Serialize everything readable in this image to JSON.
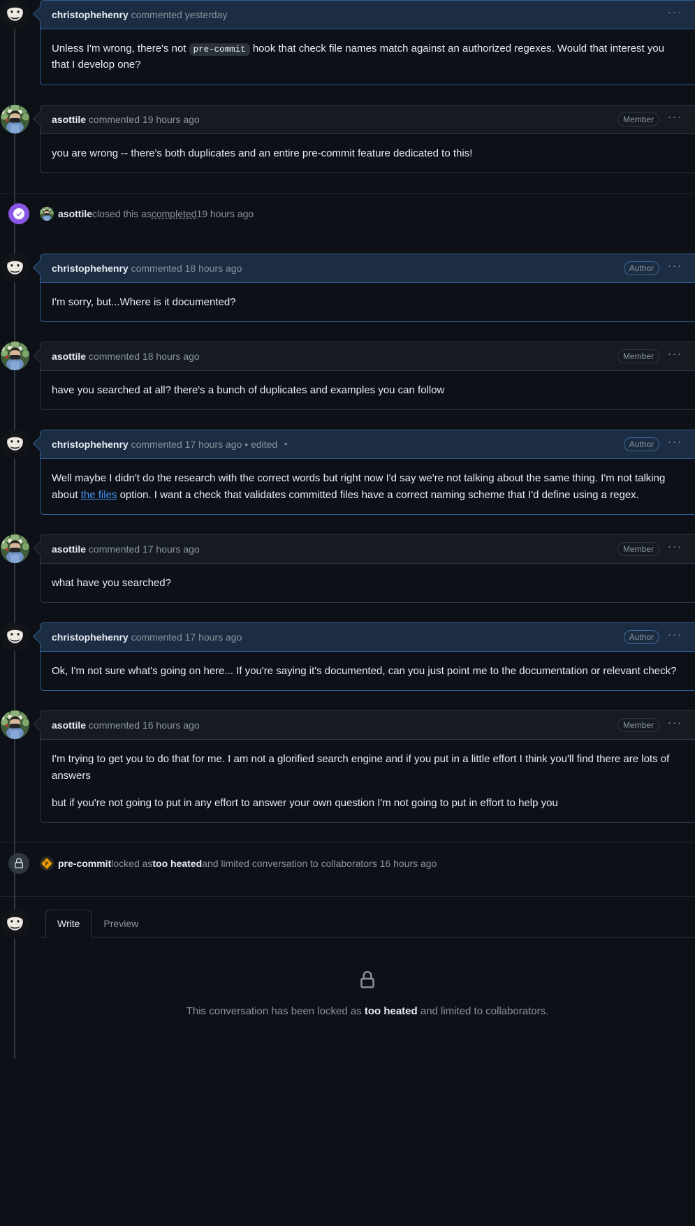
{
  "timeline": [
    {
      "type": "comment",
      "author": "christophehenry",
      "action": "commented",
      "time": "yesterday",
      "edited": "",
      "badge": "",
      "highlight": true,
      "kebab": "···",
      "avatar": "christophehenry-avatar",
      "paragraphs": [
        {
          "parts": [
            {
              "kind": "text",
              "text": "Unless I'm wrong, there's not "
            },
            {
              "kind": "code",
              "text": "pre-commit"
            },
            {
              "kind": "text",
              "text": " hook that check file names match against an authorized regexes. Would that interest you that I develop one?"
            }
          ]
        }
      ]
    },
    {
      "type": "comment",
      "author": "asottile",
      "action": "commented",
      "time": "19 hours ago",
      "edited": "",
      "badge": "Member",
      "highlight": false,
      "kebab": "···",
      "avatar": "asottile-avatar",
      "paragraphs": [
        {
          "parts": [
            {
              "kind": "text",
              "text": "you are wrong -- there's both duplicates and an entire pre-commit feature dedicated to this!"
            }
          ]
        }
      ]
    },
    {
      "type": "event",
      "icon": "closed-completed-icon",
      "icon_style": "purple",
      "actor": "asottile",
      "avatar": "asottile-avatar",
      "text_before": " closed this as ",
      "emphasis": "completed",
      "emphasis_style": "dotted",
      "text_after": " 19 hours ago"
    },
    {
      "type": "comment",
      "author": "christophehenry",
      "action": "commented",
      "time": "18 hours ago",
      "edited": "",
      "badge": "Author",
      "badge_style": "author",
      "highlight": true,
      "kebab": "···",
      "avatar": "christophehenry-avatar",
      "paragraphs": [
        {
          "parts": [
            {
              "kind": "text",
              "text": "I'm sorry, but...Where is it documented?"
            }
          ]
        }
      ]
    },
    {
      "type": "comment",
      "author": "asottile",
      "action": "commented",
      "time": "18 hours ago",
      "edited": "",
      "badge": "Member",
      "highlight": false,
      "kebab": "···",
      "avatar": "asottile-avatar",
      "paragraphs": [
        {
          "parts": [
            {
              "kind": "text",
              "text": "have you searched at all? there's a bunch of duplicates and examples you can follow"
            }
          ]
        }
      ]
    },
    {
      "type": "comment",
      "author": "christophehenry",
      "action": "commented",
      "time": "17 hours ago",
      "edited": "• edited",
      "badge": "Author",
      "badge_style": "author",
      "highlight": true,
      "kebab": "···",
      "avatar": "christophehenry-avatar",
      "paragraphs": [
        {
          "parts": [
            {
              "kind": "text",
              "text": "Well maybe I didn't do the research with the correct words but right now I'd say we're not talking about the same thing. I'm not talking about "
            },
            {
              "kind": "link",
              "text": "the files"
            },
            {
              "kind": "text",
              "text": " option. I want a check that validates committed files have a correct naming scheme that I'd define using a regex."
            }
          ]
        }
      ]
    },
    {
      "type": "comment",
      "author": "asottile",
      "action": "commented",
      "time": "17 hours ago",
      "edited": "",
      "badge": "Member",
      "highlight": false,
      "kebab": "···",
      "avatar": "asottile-avatar",
      "paragraphs": [
        {
          "parts": [
            {
              "kind": "text",
              "text": "what have you searched?"
            }
          ]
        }
      ]
    },
    {
      "type": "comment",
      "author": "christophehenry",
      "action": "commented",
      "time": "17 hours ago",
      "edited": "",
      "badge": "Author",
      "badge_style": "author",
      "highlight": true,
      "kebab": "···",
      "avatar": "christophehenry-avatar",
      "paragraphs": [
        {
          "parts": [
            {
              "kind": "text",
              "text": "Ok, I'm not sure what's going on here... If you're saying it's documented, can you just point me to the documentation or relevant check?"
            }
          ]
        }
      ]
    },
    {
      "type": "comment",
      "author": "asottile",
      "action": "commented",
      "time": "16 hours ago",
      "edited": "",
      "badge": "Member",
      "highlight": false,
      "kebab": "···",
      "avatar": "asottile-avatar",
      "paragraphs": [
        {
          "parts": [
            {
              "kind": "text",
              "text": "I'm trying to get you to do that for me. I am not a glorified search engine and if you put in a little effort I think you'll find there are lots of answers"
            }
          ]
        },
        {
          "parts": [
            {
              "kind": "text",
              "text": "but if you're not going to put in any effort to answer your own question I'm not going to put in effort to help you"
            }
          ]
        }
      ]
    },
    {
      "type": "event",
      "icon": "lock-icon",
      "icon_style": "grey",
      "actor": "pre-commit",
      "avatar": "pre-commit-avatar",
      "text_before": " locked as ",
      "emphasis": "too heated",
      "emphasis_style": "strong",
      "text_after": " and limited conversation to collaborators 16 hours ago"
    }
  ],
  "composer": {
    "avatar": "current-user-avatar",
    "tabs": [
      {
        "label": "Write",
        "active": true
      },
      {
        "label": "Preview",
        "active": false
      }
    ],
    "locked": {
      "icon": "lock-icon",
      "prefix": "This conversation has been locked as ",
      "emphasis": "too heated",
      "suffix": " and limited to collaborators."
    }
  },
  "colors": {
    "background": "#0d1117",
    "card_header": "#161b22",
    "author_header": "#1c2c42",
    "border": "#30363d",
    "author_border": "#2f5d8f",
    "muted_text": "#8b949e",
    "text": "#e6edf3",
    "link": "#4493f8",
    "closed_purple": "#8957e5",
    "precommit_orange": "#f0a30a"
  }
}
